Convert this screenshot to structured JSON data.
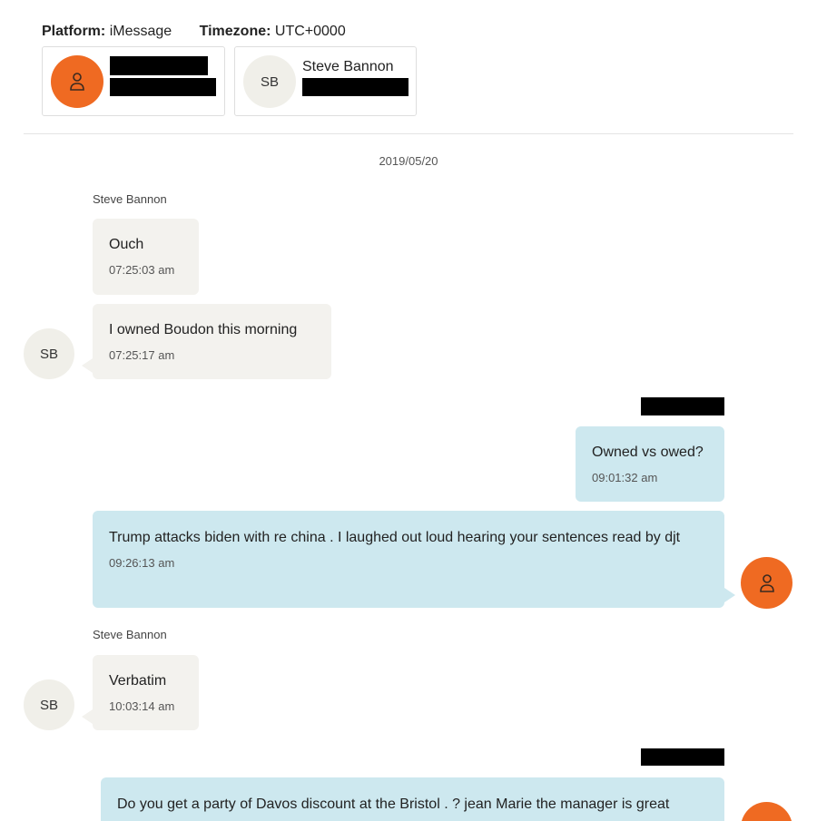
{
  "header": {
    "platform_label": "Platform:",
    "platform_value": "iMessage",
    "timezone_label": "Timezone:",
    "timezone_value": "UTC+0000"
  },
  "participants": [
    {
      "initials": "",
      "name": "",
      "avatar_color": "#ef6a22",
      "avatar_icon": "person-icon"
    },
    {
      "initials": "SB",
      "name": "Steve Bannon",
      "avatar_color": "#f0efe9"
    }
  ],
  "date_separator": "2019/05/20",
  "messages": [
    {
      "sender": "Steve Bannon",
      "text": "Ouch",
      "time": "07:25:03 am",
      "direction": "in"
    },
    {
      "sender": "Steve Bannon",
      "text": "I owned Boudon this morning",
      "time": "07:25:17 am",
      "direction": "in",
      "avatar": "SB"
    },
    {
      "sender": "",
      "text": "Owned vs owed?",
      "time": "09:01:32 am",
      "direction": "out"
    },
    {
      "sender": "",
      "text": "Trump attacks biden with re china .  I laughed out loud hearing your sentences read by djt",
      "time": "09:26:13 am",
      "direction": "out"
    },
    {
      "sender": "Steve Bannon",
      "text": "Verbatim",
      "time": "10:03:14 am",
      "direction": "in",
      "avatar": "SB"
    },
    {
      "sender": "",
      "text": "Do you get a party of Davos discount at the Bristol . ?  jean Marie the manager is great",
      "time": "",
      "direction": "out"
    }
  ],
  "colors": {
    "outgoing_bubble": "#cde8ef",
    "incoming_bubble": "#f3f2ee",
    "accent_orange": "#ef6a22"
  }
}
